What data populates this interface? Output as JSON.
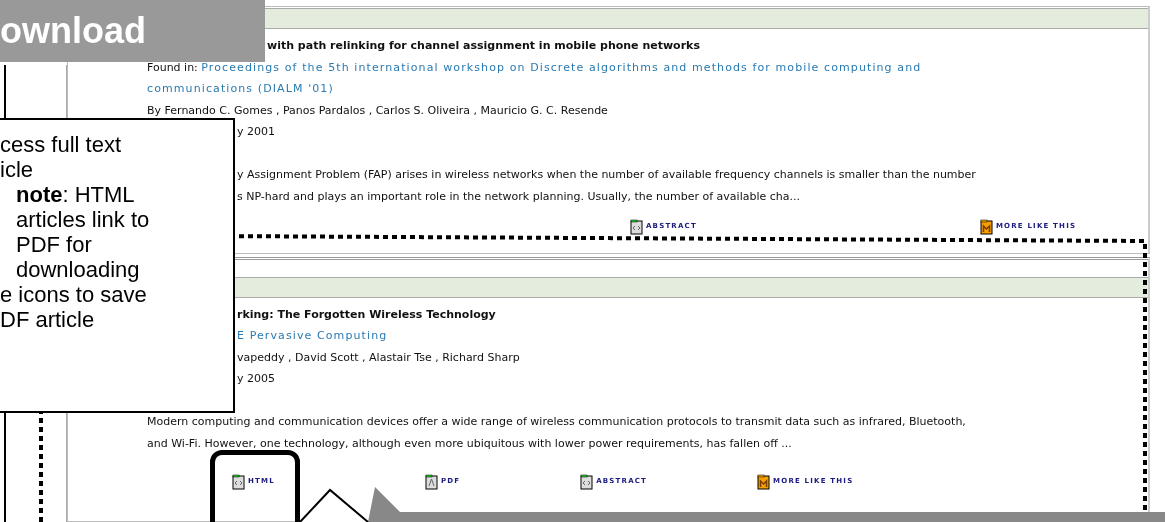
{
  "slide_title": "ownload",
  "callout": [
    {
      "kind": "text",
      "text": "cess full text"
    },
    {
      "kind": "text",
      "text": "icle"
    },
    {
      "kind": "note",
      "text": "**note**: HTML"
    },
    {
      "kind": "note",
      "text": "articles link to"
    },
    {
      "kind": "note",
      "text": "PDF for"
    },
    {
      "kind": "note",
      "text": "downloading"
    },
    {
      "kind": "text",
      "text": "e icons to save"
    },
    {
      "kind": "text",
      "text": "DF article"
    }
  ],
  "results": [
    {
      "title": "with path relinking for channel assignment in mobile phone networks",
      "found_in_label": "Found in:",
      "source": [
        "Proceedings of the 5th international workshop on Discrete algorithms and methods for mobile computing and",
        "communications (DIALM '01)"
      ],
      "authors": "By Fernando C. Gomes , Panos Pardalos , Carlos S. Oliveira , Mauricio G. C. Resende",
      "date": "y 2001",
      "abstract": [
        "y Assignment Problem (FAP) arises in wireless networks when the number of available frequency channels is smaller than the number",
        "s NP-hard and plays an important role in the network planning. Usually, the number of available cha..."
      ],
      "links": [
        {
          "kind": "abstract",
          "label": "ABSTRACT",
          "highlighted": false
        },
        {
          "kind": "more",
          "label": "MORE LIKE THIS",
          "highlighted": false
        }
      ]
    },
    {
      "title": "rking: The Forgotten Wireless Technology",
      "source": [
        "E Pervasive Computing"
      ],
      "authors": "vapeddy , David Scott , Alastair Tse , Richard Sharp",
      "date": "y 2005",
      "abstract": [
        "Modern computing and communication devices offer a wide range of wireless communication protocols to transmit data such as infrared, Bluetooth,",
        "and Wi-Fi. However, one technology, although even more ubiquitous with lower power requirements, has fallen off ..."
      ],
      "links": [
        {
          "kind": "html",
          "label": "HTML",
          "highlighted": true
        },
        {
          "kind": "pdf",
          "label": "PDF",
          "highlighted": false
        },
        {
          "kind": "abstract",
          "label": "ABSTRACT",
          "highlighted": false
        },
        {
          "kind": "more",
          "label": "MORE LIKE THIS",
          "highlighted": false
        }
      ]
    }
  ]
}
